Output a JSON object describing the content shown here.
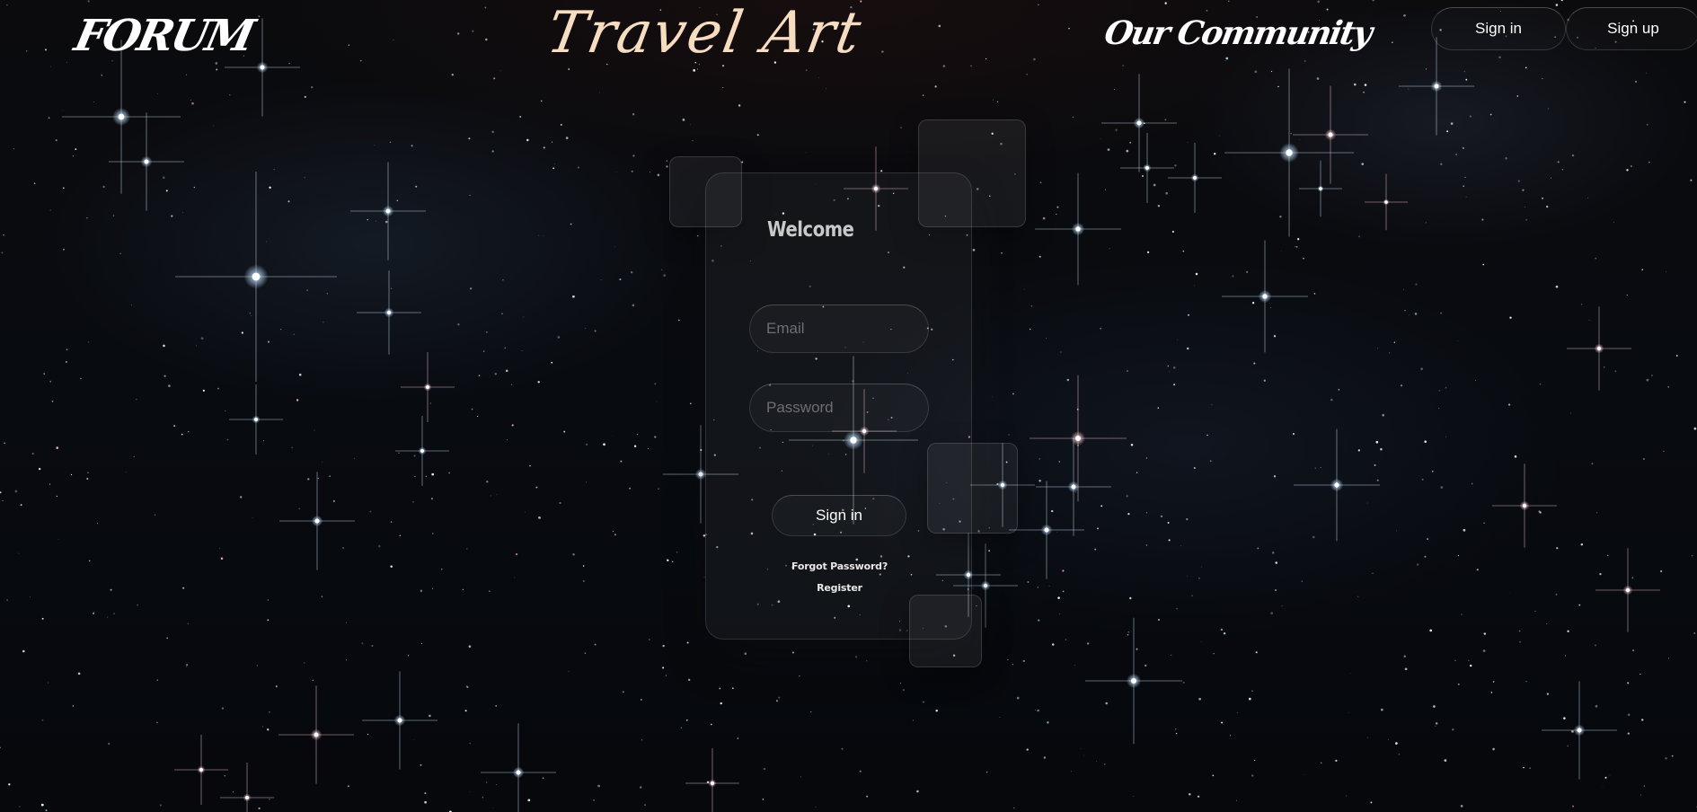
{
  "header": {
    "logo": "FORUM",
    "brand": "Travel Art",
    "community_link": "Our Community",
    "sign_in_label": "Sign in",
    "sign_up_label": "Sign up"
  },
  "login_card": {
    "heading": "Welcome",
    "email_placeholder": "Email",
    "password_placeholder": "Password",
    "submit_label": "Sign in",
    "forgot_link": "Forgot Password?",
    "register_link": "Register"
  },
  "colors": {
    "background": "#05070b",
    "brand_title": "#f6dcc0",
    "text": "#ffffff",
    "placeholder": "#6e6e72"
  }
}
